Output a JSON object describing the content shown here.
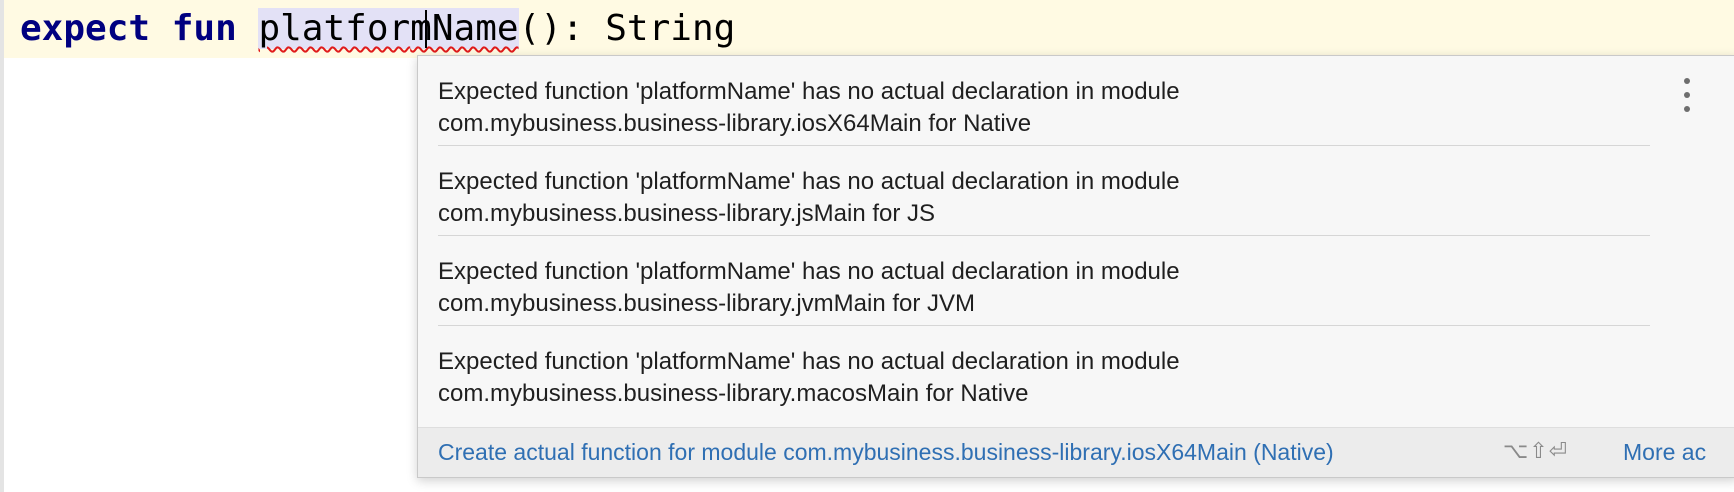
{
  "editor": {
    "code": {
      "keyword_expect": "expect",
      "keyword_fun": "fun",
      "identifier_part1": "platfor",
      "identifier_part2": "mName",
      "rest": "(): String"
    }
  },
  "popup": {
    "messages": [
      {
        "line1": "Expected function 'platformName' has no actual declaration in module",
        "line2": "com.mybusiness.business-library.iosX64Main for Native"
      },
      {
        "line1": "Expected function 'platformName' has no actual declaration in module",
        "line2": "com.mybusiness.business-library.jsMain for JS"
      },
      {
        "line1": "Expected function 'platformName' has no actual declaration in module",
        "line2": "com.mybusiness.business-library.jvmMain for JVM"
      },
      {
        "line1": "Expected function 'platformName' has no actual declaration in module",
        "line2": "com.mybusiness.business-library.macosMain for Native"
      }
    ],
    "more_menu_icon": "vertical-ellipsis-icon",
    "footer": {
      "action_label": "Create actual function for module com.mybusiness.business-library.iosX64Main (Native)",
      "shortcut": "⌥⇧⏎",
      "more_actions_label": "More ac"
    }
  },
  "colors": {
    "keyword": "#000080",
    "current_line": "#fffae3",
    "identifier_highlight": "#e3e1f6",
    "error_underline": "#e01b1b",
    "link": "#2f6fb3"
  }
}
